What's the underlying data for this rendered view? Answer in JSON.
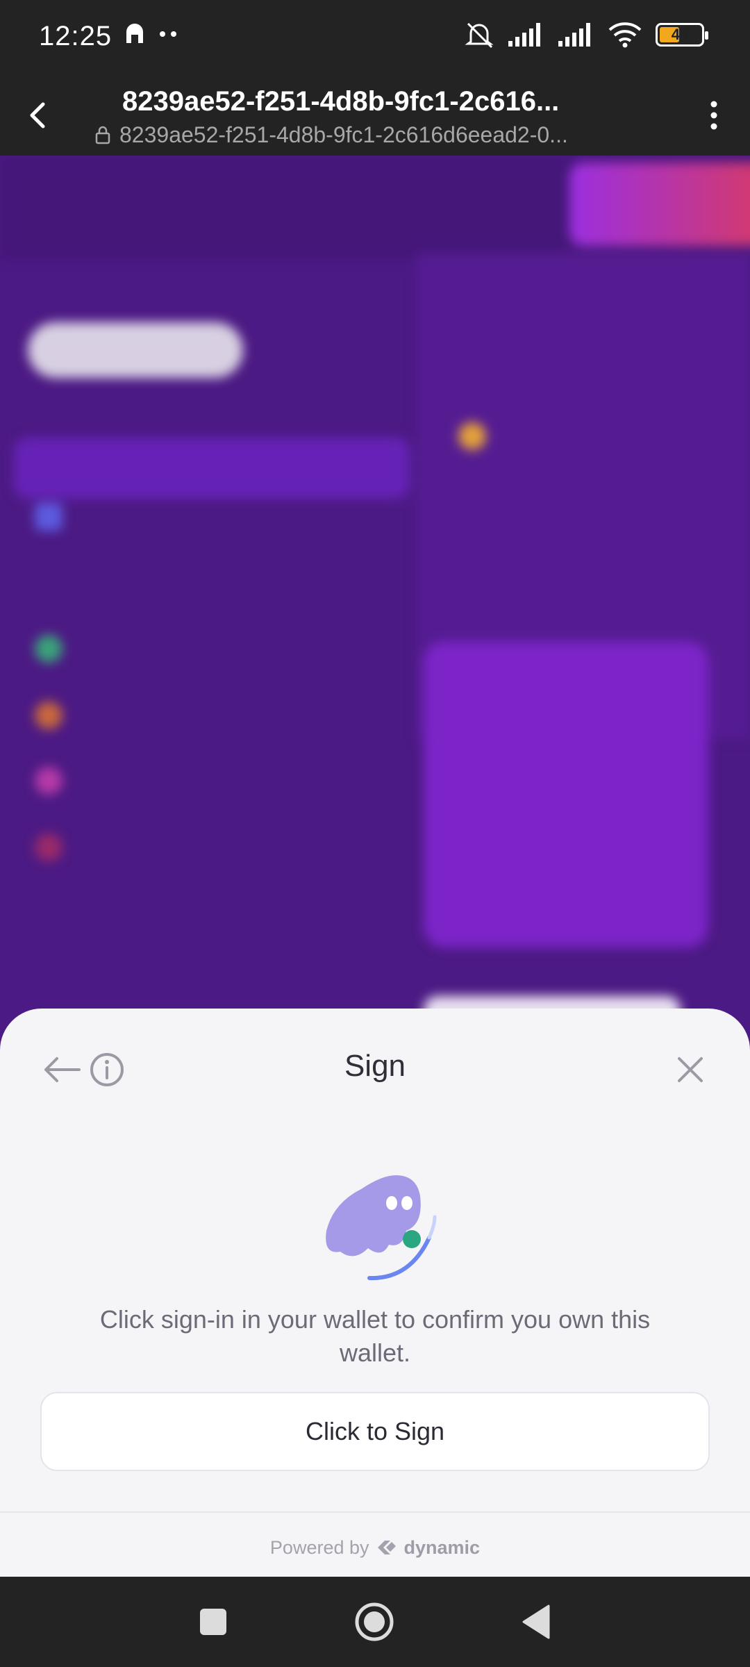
{
  "status_bar": {
    "time": "12:25",
    "battery_level": "44",
    "icons": [
      "mute-icon",
      "signal-icon",
      "signal-icon",
      "wifi-icon",
      "battery-icon"
    ]
  },
  "browser": {
    "title": "8239ae52-f251-4d8b-9fc1-2c616...",
    "url": "8239ae52-f251-4d8b-9fc1-2c616d6eead2-0..."
  },
  "sheet": {
    "title": "Sign",
    "message": "Click sign-in in your wallet to confirm you own this wallet.",
    "button_label": "Click to Sign",
    "powered_by": "Powered by",
    "brand": "dynamic"
  },
  "colors": {
    "page_background": "#4c1a84",
    "accent": "#8f1fd1",
    "sheet_background": "#f5f5f7",
    "ghost": "#a59ae8",
    "dot": "#2aa680"
  }
}
